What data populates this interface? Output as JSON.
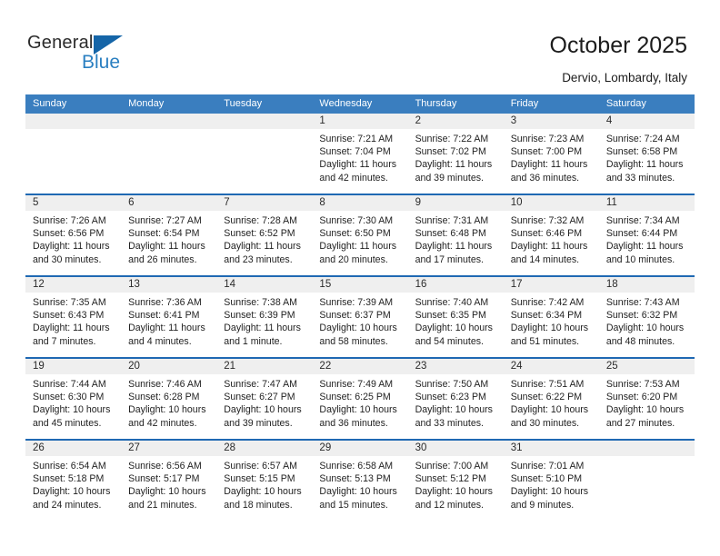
{
  "brand": {
    "name_top": "General",
    "name_bottom": "Blue",
    "accent_color": "#2a7fc1",
    "triangle_color": "#1565a8"
  },
  "header": {
    "title": "October 2025",
    "subtitle": "Dervio, Lombardy, Italy"
  },
  "theme": {
    "header_row_bg": "#3a7ebf",
    "row_divider": "#1f69b3",
    "daynum_strip_bg": "#efefef",
    "page_bg": "#ffffff",
    "text": "#1f1f1f"
  },
  "weekday_headers": [
    "Sunday",
    "Monday",
    "Tuesday",
    "Wednesday",
    "Thursday",
    "Friday",
    "Saturday"
  ],
  "labels": {
    "sunrise_prefix": "Sunrise:",
    "sunset_prefix": "Sunset:",
    "daylight_prefix": "Daylight:"
  },
  "weeks": [
    [
      {
        "day": "",
        "l1": "",
        "l2": "",
        "l3": "",
        "l4": "",
        "empty": true
      },
      {
        "day": "",
        "l1": "",
        "l2": "",
        "l3": "",
        "l4": "",
        "empty": true
      },
      {
        "day": "",
        "l1": "",
        "l2": "",
        "l3": "",
        "l4": "",
        "empty": true
      },
      {
        "day": "1",
        "l1": "Sunrise: 7:21 AM",
        "l2": "Sunset: 7:04 PM",
        "l3": "Daylight: 11 hours",
        "l4": "and 42 minutes.",
        "empty": false
      },
      {
        "day": "2",
        "l1": "Sunrise: 7:22 AM",
        "l2": "Sunset: 7:02 PM",
        "l3": "Daylight: 11 hours",
        "l4": "and 39 minutes.",
        "empty": false
      },
      {
        "day": "3",
        "l1": "Sunrise: 7:23 AM",
        "l2": "Sunset: 7:00 PM",
        "l3": "Daylight: 11 hours",
        "l4": "and 36 minutes.",
        "empty": false
      },
      {
        "day": "4",
        "l1": "Sunrise: 7:24 AM",
        "l2": "Sunset: 6:58 PM",
        "l3": "Daylight: 11 hours",
        "l4": "and 33 minutes.",
        "empty": false
      }
    ],
    [
      {
        "day": "5",
        "l1": "Sunrise: 7:26 AM",
        "l2": "Sunset: 6:56 PM",
        "l3": "Daylight: 11 hours",
        "l4": "and 30 minutes.",
        "empty": false
      },
      {
        "day": "6",
        "l1": "Sunrise: 7:27 AM",
        "l2": "Sunset: 6:54 PM",
        "l3": "Daylight: 11 hours",
        "l4": "and 26 minutes.",
        "empty": false
      },
      {
        "day": "7",
        "l1": "Sunrise: 7:28 AM",
        "l2": "Sunset: 6:52 PM",
        "l3": "Daylight: 11 hours",
        "l4": "and 23 minutes.",
        "empty": false
      },
      {
        "day": "8",
        "l1": "Sunrise: 7:30 AM",
        "l2": "Sunset: 6:50 PM",
        "l3": "Daylight: 11 hours",
        "l4": "and 20 minutes.",
        "empty": false
      },
      {
        "day": "9",
        "l1": "Sunrise: 7:31 AM",
        "l2": "Sunset: 6:48 PM",
        "l3": "Daylight: 11 hours",
        "l4": "and 17 minutes.",
        "empty": false
      },
      {
        "day": "10",
        "l1": "Sunrise: 7:32 AM",
        "l2": "Sunset: 6:46 PM",
        "l3": "Daylight: 11 hours",
        "l4": "and 14 minutes.",
        "empty": false
      },
      {
        "day": "11",
        "l1": "Sunrise: 7:34 AM",
        "l2": "Sunset: 6:44 PM",
        "l3": "Daylight: 11 hours",
        "l4": "and 10 minutes.",
        "empty": false
      }
    ],
    [
      {
        "day": "12",
        "l1": "Sunrise: 7:35 AM",
        "l2": "Sunset: 6:43 PM",
        "l3": "Daylight: 11 hours",
        "l4": "and 7 minutes.",
        "empty": false
      },
      {
        "day": "13",
        "l1": "Sunrise: 7:36 AM",
        "l2": "Sunset: 6:41 PM",
        "l3": "Daylight: 11 hours",
        "l4": "and 4 minutes.",
        "empty": false
      },
      {
        "day": "14",
        "l1": "Sunrise: 7:38 AM",
        "l2": "Sunset: 6:39 PM",
        "l3": "Daylight: 11 hours",
        "l4": "and 1 minute.",
        "empty": false
      },
      {
        "day": "15",
        "l1": "Sunrise: 7:39 AM",
        "l2": "Sunset: 6:37 PM",
        "l3": "Daylight: 10 hours",
        "l4": "and 58 minutes.",
        "empty": false
      },
      {
        "day": "16",
        "l1": "Sunrise: 7:40 AM",
        "l2": "Sunset: 6:35 PM",
        "l3": "Daylight: 10 hours",
        "l4": "and 54 minutes.",
        "empty": false
      },
      {
        "day": "17",
        "l1": "Sunrise: 7:42 AM",
        "l2": "Sunset: 6:34 PM",
        "l3": "Daylight: 10 hours",
        "l4": "and 51 minutes.",
        "empty": false
      },
      {
        "day": "18",
        "l1": "Sunrise: 7:43 AM",
        "l2": "Sunset: 6:32 PM",
        "l3": "Daylight: 10 hours",
        "l4": "and 48 minutes.",
        "empty": false
      }
    ],
    [
      {
        "day": "19",
        "l1": "Sunrise: 7:44 AM",
        "l2": "Sunset: 6:30 PM",
        "l3": "Daylight: 10 hours",
        "l4": "and 45 minutes.",
        "empty": false
      },
      {
        "day": "20",
        "l1": "Sunrise: 7:46 AM",
        "l2": "Sunset: 6:28 PM",
        "l3": "Daylight: 10 hours",
        "l4": "and 42 minutes.",
        "empty": false
      },
      {
        "day": "21",
        "l1": "Sunrise: 7:47 AM",
        "l2": "Sunset: 6:27 PM",
        "l3": "Daylight: 10 hours",
        "l4": "and 39 minutes.",
        "empty": false
      },
      {
        "day": "22",
        "l1": "Sunrise: 7:49 AM",
        "l2": "Sunset: 6:25 PM",
        "l3": "Daylight: 10 hours",
        "l4": "and 36 minutes.",
        "empty": false
      },
      {
        "day": "23",
        "l1": "Sunrise: 7:50 AM",
        "l2": "Sunset: 6:23 PM",
        "l3": "Daylight: 10 hours",
        "l4": "and 33 minutes.",
        "empty": false
      },
      {
        "day": "24",
        "l1": "Sunrise: 7:51 AM",
        "l2": "Sunset: 6:22 PM",
        "l3": "Daylight: 10 hours",
        "l4": "and 30 minutes.",
        "empty": false
      },
      {
        "day": "25",
        "l1": "Sunrise: 7:53 AM",
        "l2": "Sunset: 6:20 PM",
        "l3": "Daylight: 10 hours",
        "l4": "and 27 minutes.",
        "empty": false
      }
    ],
    [
      {
        "day": "26",
        "l1": "Sunrise: 6:54 AM",
        "l2": "Sunset: 5:18 PM",
        "l3": "Daylight: 10 hours",
        "l4": "and 24 minutes.",
        "empty": false
      },
      {
        "day": "27",
        "l1": "Sunrise: 6:56 AM",
        "l2": "Sunset: 5:17 PM",
        "l3": "Daylight: 10 hours",
        "l4": "and 21 minutes.",
        "empty": false
      },
      {
        "day": "28",
        "l1": "Sunrise: 6:57 AM",
        "l2": "Sunset: 5:15 PM",
        "l3": "Daylight: 10 hours",
        "l4": "and 18 minutes.",
        "empty": false
      },
      {
        "day": "29",
        "l1": "Sunrise: 6:58 AM",
        "l2": "Sunset: 5:13 PM",
        "l3": "Daylight: 10 hours",
        "l4": "and 15 minutes.",
        "empty": false
      },
      {
        "day": "30",
        "l1": "Sunrise: 7:00 AM",
        "l2": "Sunset: 5:12 PM",
        "l3": "Daylight: 10 hours",
        "l4": "and 12 minutes.",
        "empty": false
      },
      {
        "day": "31",
        "l1": "Sunrise: 7:01 AM",
        "l2": "Sunset: 5:10 PM",
        "l3": "Daylight: 10 hours",
        "l4": "and 9 minutes.",
        "empty": false
      },
      {
        "day": "",
        "l1": "",
        "l2": "",
        "l3": "",
        "l4": "",
        "empty": true
      }
    ]
  ]
}
